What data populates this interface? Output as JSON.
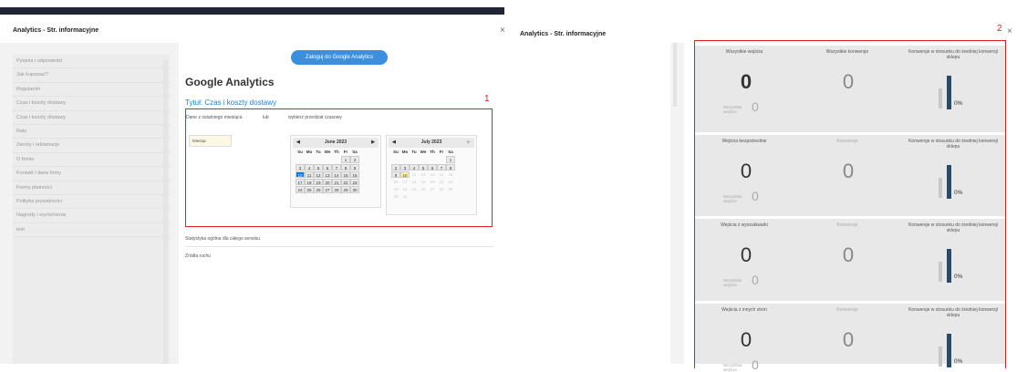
{
  "panel1": {
    "title": "Analytics - Str. informacyjne",
    "sidebar": [
      "Pytania i odpowiedzi",
      "Jak kupować?",
      "Regulamin",
      "Czas i koszty dostawy",
      "Czas i koszty dostawy",
      "Raty",
      "Zwroty i reklamacje",
      "O firmie",
      "Kontakt / dane firmy",
      "Formy płatności",
      "Polityka prywatności",
      "Nagrody i wyróżnienia",
      "test"
    ],
    "login_button": "Zaloguj do Google Analytics",
    "heading": "Google Analytics",
    "subtitle": "Tytuł: Czas i koszty dostawy",
    "label_number": "1",
    "range_last_month": "Dane z ostatniego miesiąca",
    "or": "lub",
    "choose_range": "wybierz przedział czasowy",
    "month_field": "Miesiąc",
    "cal_june": {
      "title": "June 2023",
      "prev": "◀",
      "next": "▶"
    },
    "cal_july": {
      "title": "July 2023",
      "prev": "◀",
      "next": "▶"
    },
    "weekdays": [
      "Su",
      "Mo",
      "Tu",
      "We",
      "Th",
      "Fr",
      "Sa"
    ],
    "stats_label": "Statystyka ogólna dla całego serwisu",
    "traffic_label": "Źródła ruchu"
  },
  "panel2": {
    "title": "Analytics - Str. informacyjne",
    "label_number": "2",
    "close": "×",
    "sections": [
      {
        "h1": "Wszystkie wejścia",
        "h2": "Wszystkie konwersje",
        "h3": "Konwersje w stosunku do średniej konwersji sklepu",
        "v1": "0",
        "v2": "0",
        "mini_label": "Wszystkie wejście",
        "mini_value": "0",
        "pct": "0%"
      },
      {
        "h1": "Wejścia bezpośrednie",
        "h2": "Konwersje",
        "h3": "Konwersje w stosunku do średniej konwersji sklepu",
        "v1": "0",
        "v2": "0",
        "mini_label": "Wszystkie wejście",
        "mini_value": "0",
        "pct": "0%"
      },
      {
        "h1": "Wejścia z wyszukiwarki",
        "h2": "Konwersje",
        "h3": "Konwersje w stosunku do średniej konwersji sklepu",
        "v1": "0",
        "v2": "0",
        "mini_label": "Wszystkie wejście",
        "mini_value": "0",
        "pct": "0%"
      },
      {
        "h1": "Wejścia z innych stron",
        "h2": "Konwersje",
        "h3": "Konwersje w stosunku do średniej konwersji sklepu",
        "v1": "0",
        "v2": "0",
        "mini_label": "Wszystkie wejście",
        "mini_value": "0",
        "pct": "0%"
      }
    ]
  },
  "colors": {
    "accent": "#1a73e8",
    "highlight": "#e02020",
    "bar_dark": "#2b4a6b",
    "bar_light": "#c8c8c8"
  }
}
